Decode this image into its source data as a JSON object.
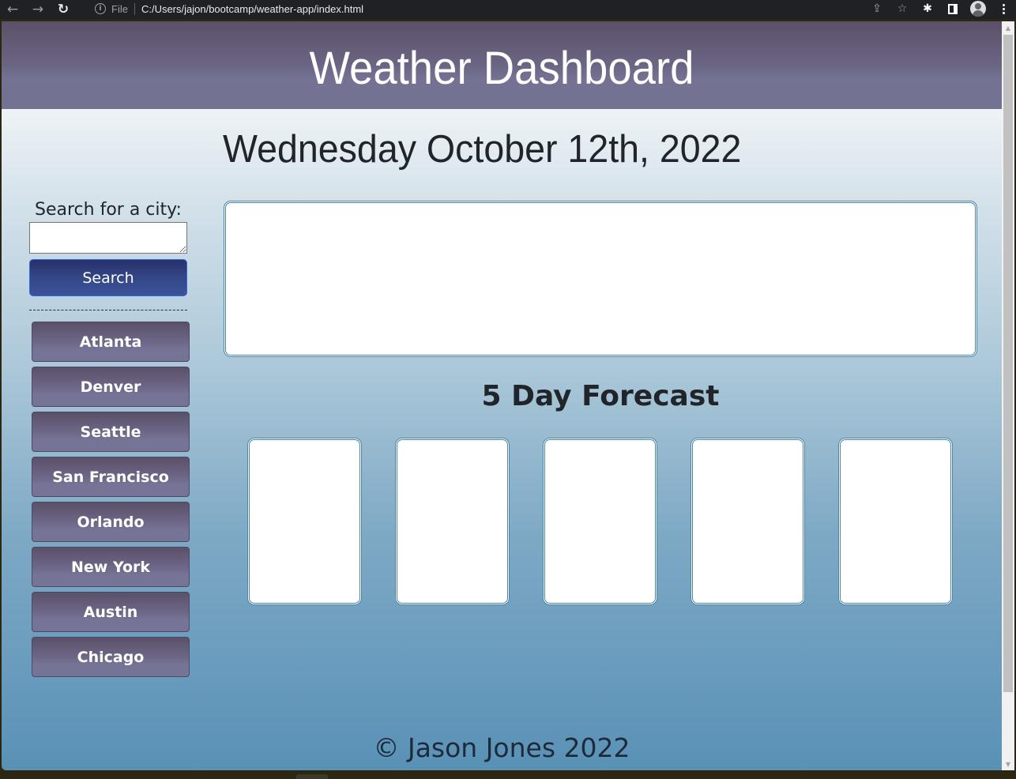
{
  "browser": {
    "back_icon": "←",
    "forward_icon": "→",
    "reload_icon": "↻",
    "info_icon": "i",
    "scheme_label": "File",
    "url": "C:/Users/jajon/bootcamp/weather-app/index.html",
    "share_icon": "⇪",
    "star_icon": "☆",
    "extensions_icon": "✱"
  },
  "header": {
    "title": "Weather Dashboard"
  },
  "current_date": "Wednesday October 12th, 2022",
  "search": {
    "label": "Search for a city:",
    "input_value": "",
    "button_label": "Search"
  },
  "cities": [
    "Atlanta",
    "Denver",
    "Seattle",
    "San Francisco",
    "Orlando",
    "New York",
    "Austin",
    "Chicago"
  ],
  "forecast": {
    "title": "5 Day Forecast",
    "days": 5
  },
  "footer": {
    "text": "© Jason Jones 2022"
  },
  "colors": {
    "header_bg": "#737293",
    "search_button": "#354a8c",
    "city_button": "#757396",
    "card_border": "#4a86a8"
  },
  "scrollbar": {
    "up_icon": "▲",
    "down_icon": "▼"
  }
}
